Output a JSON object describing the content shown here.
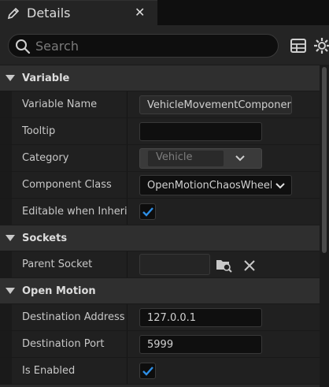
{
  "tab": {
    "title": "Details",
    "close_glyph": "✕",
    "icon": "pencil-icon"
  },
  "search": {
    "placeholder": "Search",
    "value": ""
  },
  "toolbar": {
    "icons": [
      "table-view-icon",
      "settings-gear-icon"
    ]
  },
  "sections": {
    "variable": {
      "title": "Variable",
      "variable_name_label": "Variable Name",
      "variable_name_value": "VehicleMovementComponent",
      "tooltip_label": "Tooltip",
      "tooltip_value": "",
      "category_label": "Category",
      "category_value": "Vehicle",
      "component_class_label": "Component Class",
      "component_class_value": "OpenMotionChaosWheeledVehicleMovementComponent",
      "editable_label": "Editable when Inherited",
      "editable_checked": true
    },
    "sockets": {
      "title": "Sockets",
      "parent_socket_label": "Parent Socket",
      "parent_socket_value": ""
    },
    "open_motion": {
      "title": "Open Motion",
      "destination_address_label": "Destination Address",
      "destination_address_value": "127.0.0.1",
      "destination_port_label": "Destination Port",
      "destination_port_value": "5999",
      "is_enabled_label": "Is Enabled",
      "is_enabled_checked": true
    }
  },
  "colors": {
    "background": "#151515",
    "accent_check": "#2e8fe6",
    "section_header": "#2f2f2f"
  }
}
